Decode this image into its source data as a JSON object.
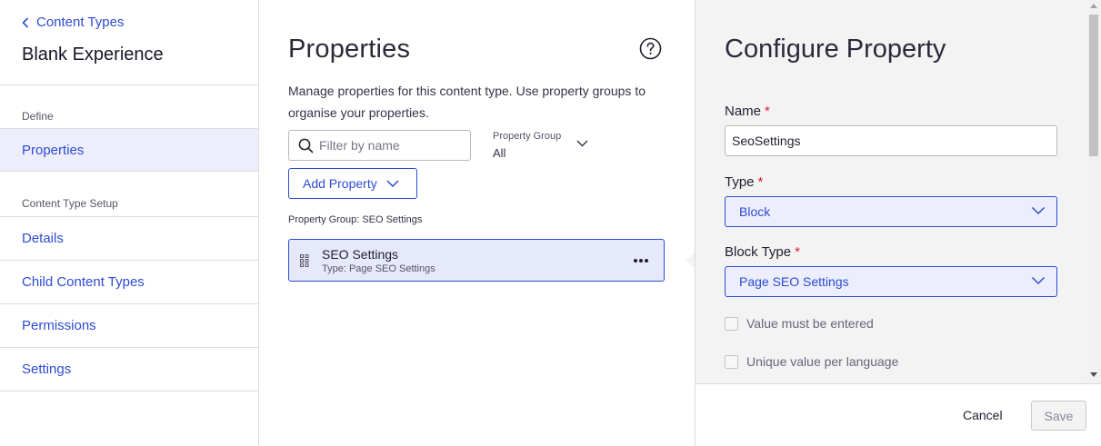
{
  "sidebar": {
    "back_label": "Content Types",
    "title": "Blank Experience",
    "section_define": "Define",
    "items_define": [
      {
        "label": "Properties"
      }
    ],
    "section_setup": "Content Type Setup",
    "items_setup": [
      {
        "label": "Details"
      },
      {
        "label": "Child Content Types"
      },
      {
        "label": "Permissions"
      },
      {
        "label": "Settings"
      }
    ]
  },
  "properties": {
    "title": "Properties",
    "description": "Manage properties for this content type. Use property groups to organise your properties.",
    "filter_placeholder": "Filter by name",
    "group_select_label": "Property Group",
    "group_select_value": "All",
    "add_button": "Add Property",
    "group_header": "Property Group: SEO Settings",
    "items": [
      {
        "name": "SEO Settings",
        "type": "Type: Page SEO Settings"
      }
    ]
  },
  "configure": {
    "title": "Configure Property",
    "name_label": "Name",
    "name_value": "SeoSettings",
    "type_label": "Type",
    "type_value": "Block",
    "block_type_label": "Block Type",
    "block_type_value": "Page SEO Settings",
    "required_marker": "*",
    "check_required": "Value must be entered",
    "check_unique": "Unique value per language",
    "cancel": "Cancel",
    "save": "Save"
  },
  "colors": {
    "accent": "#2e4bd4",
    "required": "#d8202f",
    "panel_bg": "#f3f3f4",
    "selected_bg": "#e6e9fb"
  }
}
